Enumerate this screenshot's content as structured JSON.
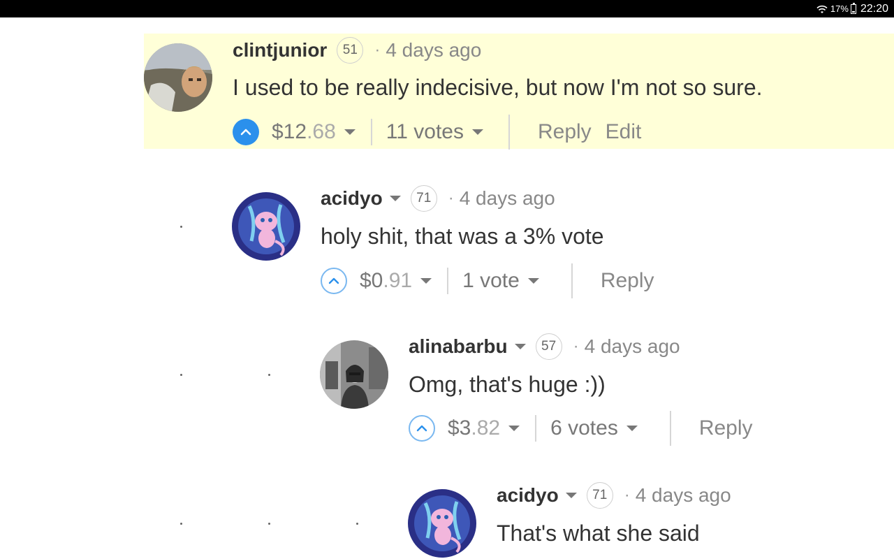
{
  "status_bar": {
    "battery": "17%",
    "time": "22:20",
    "icons": [
      "wifi-icon",
      "battery-icon"
    ]
  },
  "colors": {
    "highlight_bg": "#ffffd8",
    "upvote_active": "#2b90ec",
    "upvote_idle_border": "#7ab8f0"
  },
  "comments": [
    {
      "author": "clintjunior",
      "reputation": "51",
      "separator": "·",
      "time": "4 days ago",
      "body": "I used to be really indecisive, but now I'm not so sure.",
      "payout_whole": "$12",
      "payout_cents": ".68",
      "votes": "11 votes",
      "reply": "Reply",
      "edit": "Edit",
      "upvoted": true
    },
    {
      "author": "acidyo",
      "reputation": "71",
      "separator": "·",
      "time": "4 days ago",
      "body": "holy shit, that was a 3% vote",
      "payout_whole": "$0",
      "payout_cents": ".91",
      "votes": "1 vote",
      "reply": "Reply",
      "upvoted": false
    },
    {
      "author": "alinabarbu",
      "reputation": "57",
      "separator": "·",
      "time": "4 days ago",
      "body": "Omg, that's huge :))",
      "payout_whole": "$3",
      "payout_cents": ".82",
      "votes": "6 votes",
      "reply": "Reply",
      "upvoted": false
    },
    {
      "author": "acidyo",
      "reputation": "71",
      "separator": "·",
      "time": "4 days ago",
      "body": "That's what she said"
    }
  ]
}
